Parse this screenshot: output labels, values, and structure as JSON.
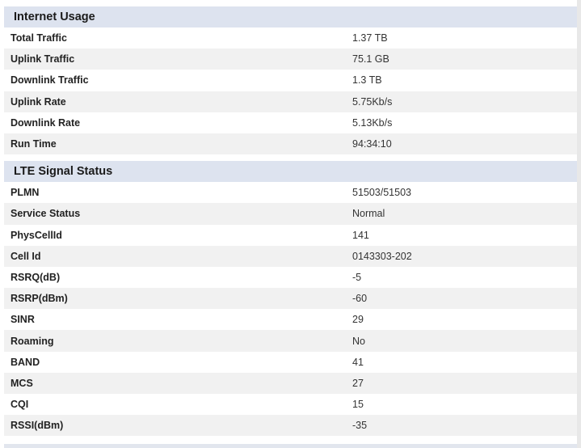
{
  "internet_usage": {
    "title": "Internet Usage",
    "rows": [
      {
        "label": "Total Traffic",
        "value": "1.37 TB"
      },
      {
        "label": "Uplink Traffic",
        "value": "75.1 GB"
      },
      {
        "label": "Downlink Traffic",
        "value": "1.3 TB"
      },
      {
        "label": "Uplink Rate",
        "value": "5.75Kb/s"
      },
      {
        "label": "Downlink Rate",
        "value": "5.13Kb/s"
      },
      {
        "label": "Run Time",
        "value": "94:34:10"
      }
    ]
  },
  "lte_signal_status": {
    "title": "LTE Signal Status",
    "rows": [
      {
        "label": "PLMN",
        "value": "51503/51503"
      },
      {
        "label": "Service Status",
        "value": "Normal"
      },
      {
        "label": "PhysCellId",
        "value": "141"
      },
      {
        "label": "Cell Id",
        "value": "0143303-202"
      },
      {
        "label": "RSRQ(dB)",
        "value": "-5"
      },
      {
        "label": "RSRP(dBm)",
        "value": "-60"
      },
      {
        "label": "SINR",
        "value": "29"
      },
      {
        "label": "Roaming",
        "value": "No"
      },
      {
        "label": "BAND",
        "value": "41"
      },
      {
        "label": "MCS",
        "value": "27"
      },
      {
        "label": "CQI",
        "value": "15"
      },
      {
        "label": "RSSI(dBm)",
        "value": "-35"
      }
    ]
  }
}
